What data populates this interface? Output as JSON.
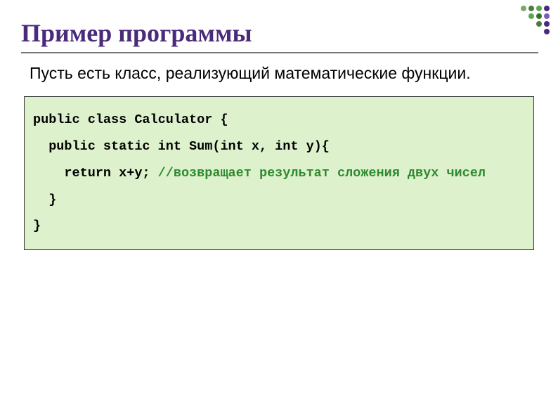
{
  "slide": {
    "title": "Пример программы",
    "description": "Пусть есть класс, реализующий математические функции.",
    "code": {
      "line1": "public class Calculator {",
      "line2": "  public static int Sum(int x, int y){",
      "line3_code": "    return x+y; ",
      "line3_comment": "//возвращает результат сложения двух чисел",
      "line4": "  }",
      "line5": "}"
    }
  }
}
